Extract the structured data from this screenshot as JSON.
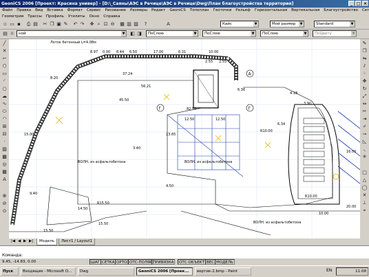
{
  "window": {
    "title": "GeoniCS 2006 [Проект: Красина универ] - [D:\\_Саяны\\АЭС в Речице\\АЭС в Речице\\Dwg\\План благоустройства территории]",
    "buttons": [
      "_",
      "□",
      "×"
    ]
  },
  "menu": {
    "row1": [
      "Файл",
      "Правка",
      "Вид",
      "Вставка",
      "Формат",
      "Сервис",
      "Рисование",
      "Размеры",
      "Редакт",
      "GeoniCS",
      "Топоплан",
      "Геоточки",
      "Рельеф",
      "Горизонтальная",
      "Вертикальная",
      "Благоустройство",
      "Сети"
    ],
    "row2": [
      "Геометрия",
      "Трассы",
      "Профиль",
      "Утилиты",
      "Окно",
      "Справка"
    ]
  },
  "toolbar": {
    "style_combo": "Кайс",
    "size_combo": "Мой размер",
    "standard_combo": "Standard",
    "layer_combo": "ной",
    "color_combo": "ПоСлою",
    "linetype_combo": "ПоСлою",
    "lineweight_combo": "ПоСлою",
    "plotstyle_combo": "ПоЦвету"
  },
  "drawing": {
    "labels": [
      "Лоток бетонный L=4.08м",
      "8.97",
      "0.00",
      "8.44",
      "6.50",
      "17.00",
      "6.31",
      "10.00",
      "37.24",
      "45.50",
      "56.21",
      "82.50",
      "12.50",
      "12.50",
      "13.65",
      "R10.00",
      "R10.00",
      "14.50",
      "15.50",
      "15.50",
      "4.50",
      "R15.50",
      "6.36",
      "4.18",
      "3.90",
      "16.00",
      "20.00",
      "ВОЛН. из асфальтобетона",
      "ВОЛН. из асфальтобетона",
      "ВОЛН. из асфальтобетона",
      "8.20",
      "15.00",
      "9.40",
      "3.40",
      "6.34",
      "2.55",
      "2.55",
      "10.00",
      "A",
      "Г",
      "Г"
    ]
  },
  "tabs": {
    "nav": [
      "|◀",
      "◀",
      "▶",
      "▶|"
    ],
    "model": "Модель",
    "layout": "Лист1 / Layout1"
  },
  "command": {
    "label": "Команда:",
    "value": ""
  },
  "status": {
    "coords": "9.45, -14.83, 0.00",
    "toggles": [
      "ШАГ",
      "СЕТКА",
      "ОРТО",
      "ОТС-ПОЛЯР",
      "ПРИВЯЗКА",
      "ОТС-ОБЪЕКТ",
      "ВЕС",
      "МОДЕЛЬ"
    ]
  },
  "taskbar": {
    "start": "Пуск",
    "tasks": [
      {
        "label": "Входящие - Microsoft O...",
        "active": false
      },
      {
        "label": "Dwg",
        "active": false
      },
      {
        "label": "GeoniCS 2006 [Проек...",
        "active": true
      },
      {
        "label": "вертик-2.bmp - Paint",
        "active": false
      }
    ],
    "lang": "EN",
    "time": "11:08"
  }
}
